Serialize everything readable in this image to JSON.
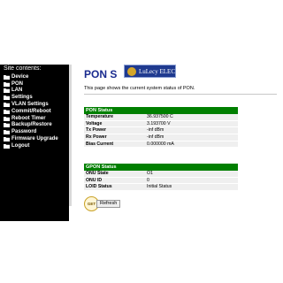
{
  "sidebar": {
    "title": "Site contents:",
    "items": [
      {
        "label": "Device"
      },
      {
        "label": "PON"
      },
      {
        "label": "LAN"
      },
      {
        "label": "Settings"
      },
      {
        "label": "VLAN Settings"
      },
      {
        "label": "Commit/Reboot"
      },
      {
        "label": "Reboot Timer"
      },
      {
        "label": "Backup/Restore"
      },
      {
        "label": "Password"
      },
      {
        "label": "Firmware Upgrade"
      },
      {
        "label": "Logout"
      }
    ]
  },
  "main": {
    "title": "PON S",
    "watermark": "LuLecy ELEC",
    "intro": "This page shows the current system status of PON."
  },
  "pon_status": {
    "header": "PON Status",
    "rows": [
      {
        "label": "Temperature",
        "value": "36.937500 C"
      },
      {
        "label": "Voltage",
        "value": "3.193700 V"
      },
      {
        "label": "Tx Power",
        "value": "-inf dBm"
      },
      {
        "label": "Rx Power",
        "value": "-inf dBm"
      },
      {
        "label": "Bias Current",
        "value": "0.000000 mA"
      }
    ]
  },
  "gpon_status": {
    "header": "GPON Status",
    "rows": [
      {
        "label": "ONU State",
        "value": "O1"
      },
      {
        "label": "ONU ID",
        "value": "0"
      },
      {
        "label": "LOID Status",
        "value": "Initial Status"
      }
    ]
  },
  "refresh": {
    "badge": "GET",
    "label": "Refresh"
  },
  "colors": {
    "nav_bg": "#000000",
    "section_header": "#007f00",
    "title": "#1a2b8f"
  }
}
